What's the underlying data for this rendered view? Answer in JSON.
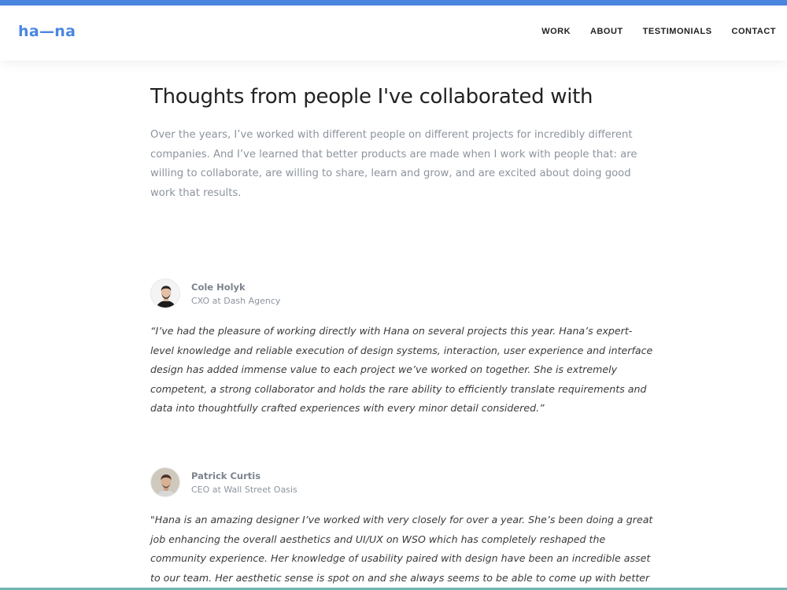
{
  "brand": {
    "logo_text": "ha—na",
    "accent_color": "#4a86e0"
  },
  "nav": {
    "items": [
      {
        "label": "WORK"
      },
      {
        "label": "ABOUT"
      },
      {
        "label": "TESTIMONIALS"
      },
      {
        "label": "CONTACT"
      }
    ]
  },
  "page": {
    "title": "Thoughts from people I've collaborated with",
    "intro": "Over the years, I’ve worked with different people on different projects for incredibly different companies. And I’ve learned that better products are made when I work with people that: are willing to collaborate, are willing to share, learn and grow, and are excited about doing good work that results."
  },
  "testimonials": [
    {
      "name": "Cole Holyk",
      "role": "CXO at Dash Agency",
      "quote": "“I’ve had the pleasure of working directly with Hana on several projects this year. Hana’s expert-level knowledge and reliable execution of design systems, interaction, user experience and interface design has added immense value to each project we’ve worked on together. She is extremely competent, a strong collaborator and holds the rare ability to efficiently translate requirements and data into thoughtfully crafted experiences with every minor detail considered.”"
    },
    {
      "name": "Patrick Curtis",
      "role": "CEO at Wall Street Oasis",
      "quote": "\"Hana is an amazing designer I’ve worked with very closely for over a year. She’s been doing a great job enhancing the overall aesthetics and UI/UX on WSO which has completely reshaped the community experience. Her knowledge of usability paired with design have been an incredible asset to our team. Her aesthetic sense is spot on and she always seems to be able to come up with better"
    }
  ]
}
